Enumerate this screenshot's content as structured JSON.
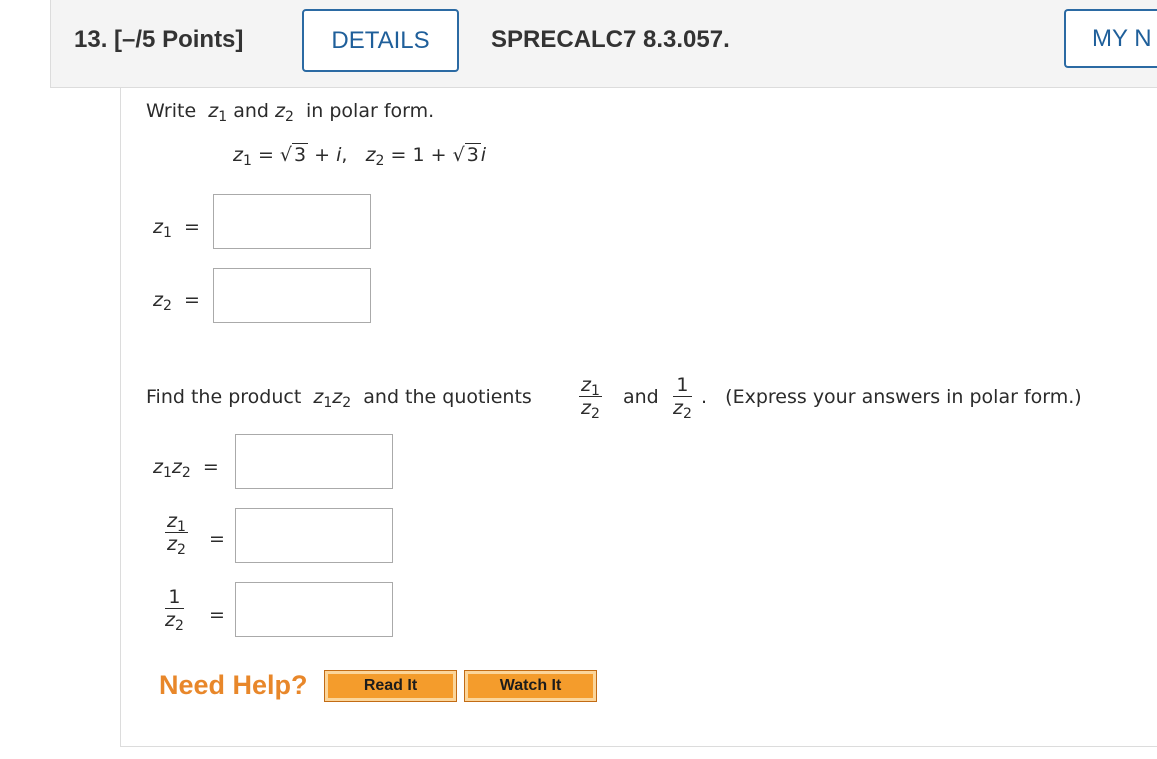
{
  "header": {
    "question_number": "13.",
    "points": "[–/5 Points]",
    "details_label": "DETAILS",
    "question_code": "SPRECALC7 8.3.057.",
    "my_notes_label": "MY N"
  },
  "problem": {
    "intro_prefix": "Write",
    "intro_and": "and",
    "intro_suffix": "in polar form.",
    "z1_given": "3 + i,",
    "z2_given_prefix": "= 1 +",
    "z2_given_rad": "3",
    "find_text": "Find the product",
    "find_and_quot": "and the quotients",
    "find_and": "and",
    "express_note": "(Express your answers in polar form.)"
  },
  "labels": {
    "z": "z",
    "sub1": "1",
    "sub2": "2",
    "eq": "=",
    "one": "1",
    "i": "i",
    "sqrt3": "3"
  },
  "help": {
    "need_help": "Need Help?",
    "read_it": "Read It",
    "watch_it": "Watch It"
  }
}
